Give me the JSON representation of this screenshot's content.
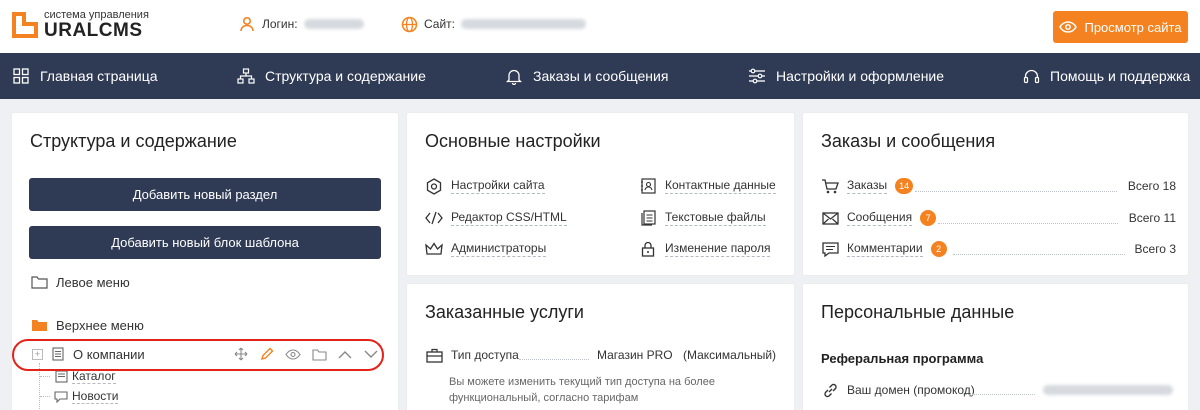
{
  "header": {
    "logo_small": "система управления",
    "logo_big": "URALCMS",
    "login_label": "Логин:",
    "site_label": "Сайт:",
    "view_site_button": "Просмотр сайта"
  },
  "nav": {
    "items": [
      {
        "label": "Главная страница",
        "icon": "grid-icon"
      },
      {
        "label": "Структура и содержание",
        "icon": "sitemap-icon"
      },
      {
        "label": "Заказы и сообщения",
        "icon": "bell-icon"
      },
      {
        "label": "Настройки и оформление",
        "icon": "sliders-icon"
      },
      {
        "label": "Помощь и поддержка",
        "icon": "headset-icon"
      }
    ]
  },
  "structure": {
    "title": "Структура и содержание",
    "add_section_button": "Добавить новый раздел",
    "add_block_button": "Добавить новый блок шаблона",
    "left_menu": "Левое меню",
    "top_menu": "Верхнее меню",
    "items": [
      {
        "label": "О компании"
      },
      {
        "label": "Каталог"
      },
      {
        "label": "Новости"
      }
    ]
  },
  "settings": {
    "title": "Основные настройки",
    "left_links": [
      "Настройки сайта",
      "Редактор CSS/HTML",
      "Администраторы"
    ],
    "right_links": [
      "Контактные данные",
      "Текстовые файлы",
      "Изменение пароля"
    ]
  },
  "orders": {
    "title": "Заказы и сообщения",
    "rows": [
      {
        "label": "Заказы",
        "badge": "14",
        "total": "Всего 18"
      },
      {
        "label": "Сообщения",
        "badge": "7",
        "total": "Всего 11"
      },
      {
        "label": "Комментарии",
        "badge": "2",
        "total": "Всего 3"
      }
    ]
  },
  "services": {
    "title": "Заказанные услуги",
    "access_label": "Тип доступа",
    "access_value": "Магазин PRO",
    "access_note": "(Максимальный)",
    "description_line1": "Вы можете изменить текущий тип доступа на более",
    "description_line2": "функциональный, согласно тарифам"
  },
  "personal": {
    "title": "Персональные данные",
    "referral_title": "Реферальная программа",
    "domain_label": "Ваш домен (промокод)"
  },
  "colors": {
    "accent": "#f58220",
    "nav_bg": "#2f3a55",
    "highlight": "#e32219"
  }
}
